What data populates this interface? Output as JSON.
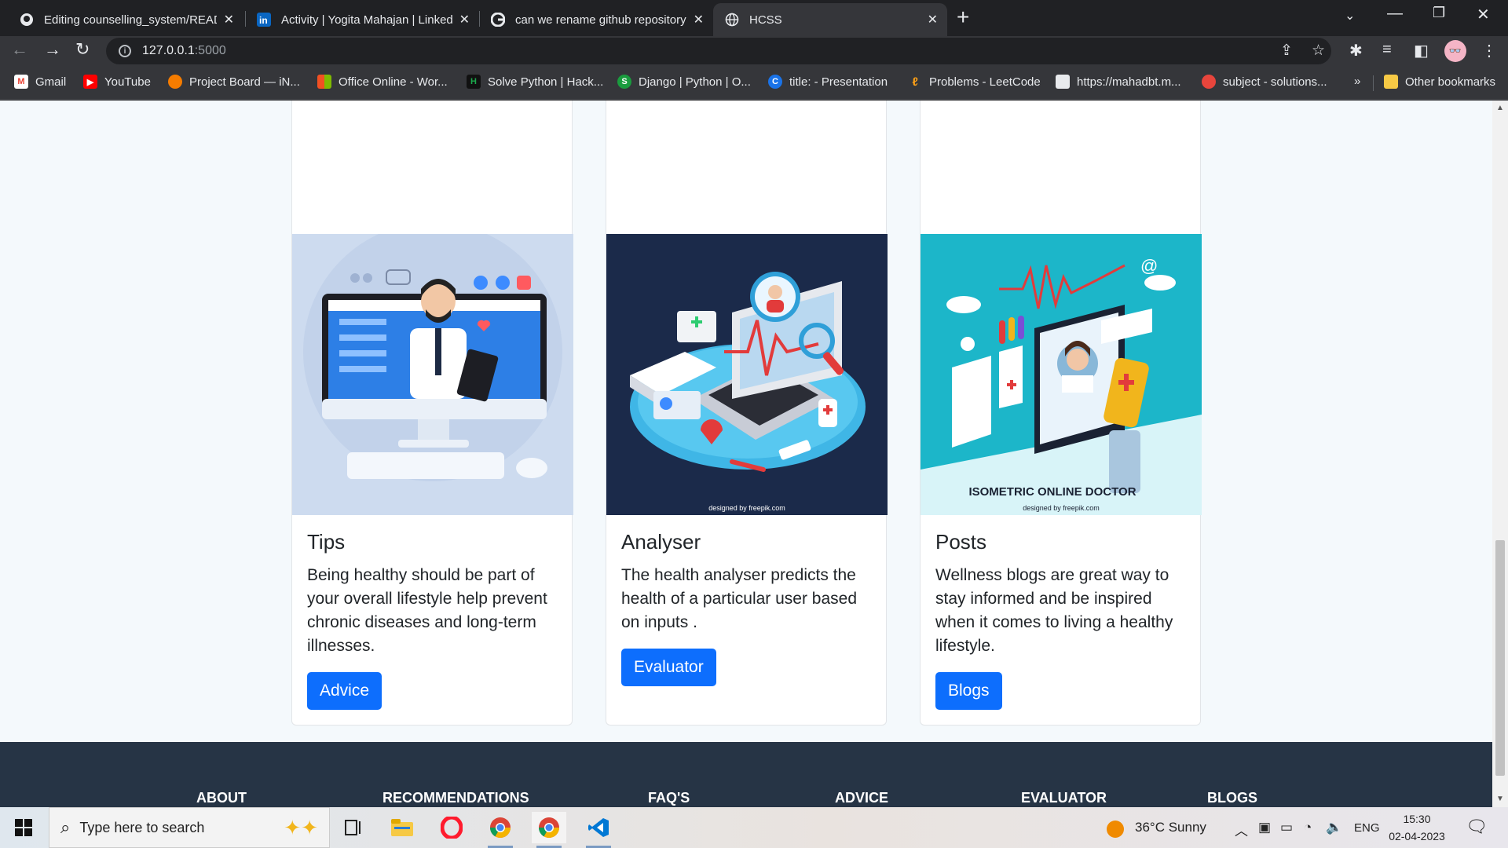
{
  "browser": {
    "tabs": [
      {
        "title": "Editing counselling_system/READ",
        "icon": "github-icon"
      },
      {
        "title": "Activity | Yogita Mahajan | Linked",
        "icon": "linkedin-icon"
      },
      {
        "title": "can we rename github repository",
        "icon": "google-icon"
      },
      {
        "title": "HCSS",
        "icon": "globe-icon"
      }
    ],
    "url_host": "127.0.0.1",
    "url_port": ":5000",
    "bookmarks": [
      {
        "label": "Gmail",
        "color": "#ea4335"
      },
      {
        "label": "YouTube",
        "color": "#ff0000"
      },
      {
        "label": "Project Board — iN...",
        "color": "#f57c00"
      },
      {
        "label": "Office Online - Wor...",
        "color": "#2b7cd3"
      },
      {
        "label": "Solve Python | Hack...",
        "color": "#1ba94c"
      },
      {
        "label": "Django | Python | O...",
        "color": "#f0c419"
      },
      {
        "label": "title: - Presentation",
        "color": "#1a73e8"
      },
      {
        "label": "Problems - LeetCode",
        "color": "#ffa116"
      },
      {
        "label": "https://mahadbt.m...",
        "color": "#e8eaed"
      },
      {
        "label": "subject - solutions...",
        "color": "#e8453c"
      }
    ],
    "overflow": "»",
    "other_bookmarks": "Other bookmarks"
  },
  "cards": [
    {
      "title": "Tips",
      "text": "Being healthy should be part of your overall lifestyle help prevent chronic diseases and long-term illnesses.",
      "button": "Advice"
    },
    {
      "title": "Analyser",
      "text": "The health analyser predicts the health of a particular user based on inputs .",
      "button": "Evaluator",
      "credit": "designed by freepik.com"
    },
    {
      "title": "Posts",
      "text": "Wellness blogs are great way to stay informed and be inspired when it comes to living a healthy lifestyle.",
      "button": "Blogs",
      "banner": "ISOMETRIC ONLINE DOCTOR",
      "credit": "designed by freepik.com"
    }
  ],
  "footer": {
    "links": [
      "ABOUT",
      "RECOMMENDATIONS",
      "FAQ'S",
      "ADVICE",
      "EVALUATOR",
      "BLOGS"
    ]
  },
  "taskbar": {
    "search_placeholder": "Type here to search",
    "weather": "36°C  Sunny",
    "language": "ENG",
    "time": "15:30",
    "date": "02-04-2023"
  }
}
